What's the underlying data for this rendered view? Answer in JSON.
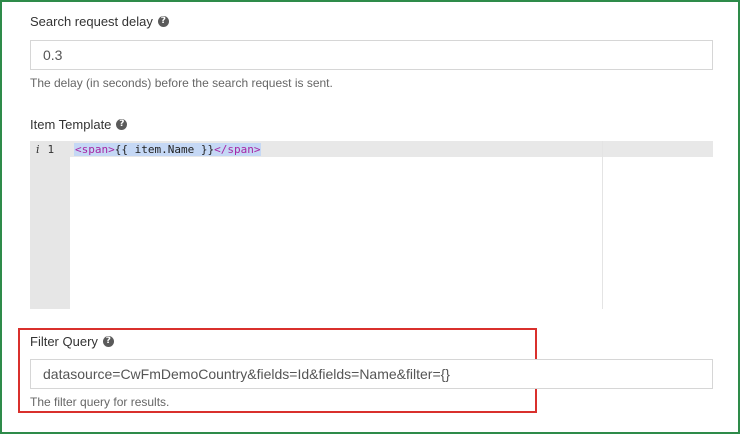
{
  "search_delay": {
    "label": "Search request delay",
    "value": "0.3",
    "help": "The delay (in seconds) before the search request is sent."
  },
  "item_template": {
    "label": "Item Template",
    "gutter_info": "i",
    "line_number": "1",
    "code_open_tag": "<span>",
    "code_text": "{{ item.Name }}",
    "code_close_tag": "</span>"
  },
  "filter_query": {
    "label": "Filter Query",
    "value": "datasource=CwFmDemoCountry&fields=Id&fields=Name&filter={}",
    "help": "The filter query for results."
  },
  "help_icon_glyph": "?",
  "colors": {
    "frame_border": "#2e8b4a",
    "highlight_border": "#d9302c",
    "tag_color": "#a626a4",
    "selection": "#c5d8f5"
  }
}
